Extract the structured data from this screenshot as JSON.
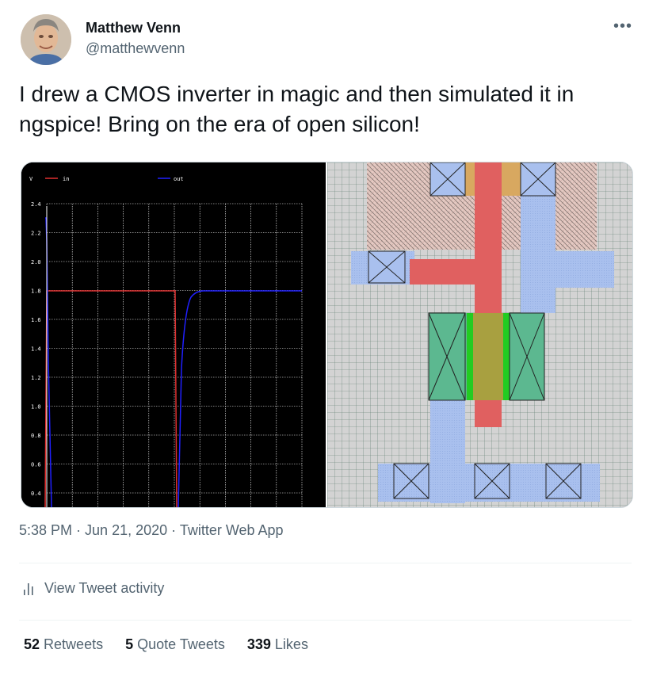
{
  "author": {
    "display_name": "Matthew Venn",
    "handle": "@matthewvenn"
  },
  "menu_icon": "more-icon",
  "tweet": {
    "text": "I drew a CMOS inverter in magic and then simulated it in ngspice! Bring on the era of open silicon!"
  },
  "media": {
    "plot": {
      "y_ticks": [
        "2.4",
        "2.2",
        "2.0",
        "1.8",
        "1.6",
        "1.4",
        "1.2",
        "1.0",
        "0.8",
        "0.6",
        "0.4"
      ],
      "axis_corner": "V",
      "legend": [
        {
          "name": "in",
          "color": "#e03030"
        },
        {
          "name": "out",
          "color": "#2020ff"
        }
      ]
    }
  },
  "meta": {
    "time": "5:38 PM",
    "separator1": " · ",
    "date": "Jun 21, 2020",
    "separator2": " · ",
    "app": "Twitter Web App"
  },
  "activity": {
    "label": "View Tweet activity",
    "icon": "analytics-icon"
  },
  "stats": {
    "retweets": {
      "count": "52",
      "label": "Retweets"
    },
    "quotes": {
      "count": "5",
      "label": "Quote Tweets"
    },
    "likes": {
      "count": "339",
      "label": "Likes"
    }
  },
  "colors": {
    "text_primary": "#0f1419",
    "text_secondary": "#536471",
    "border": "#eff3f4"
  }
}
